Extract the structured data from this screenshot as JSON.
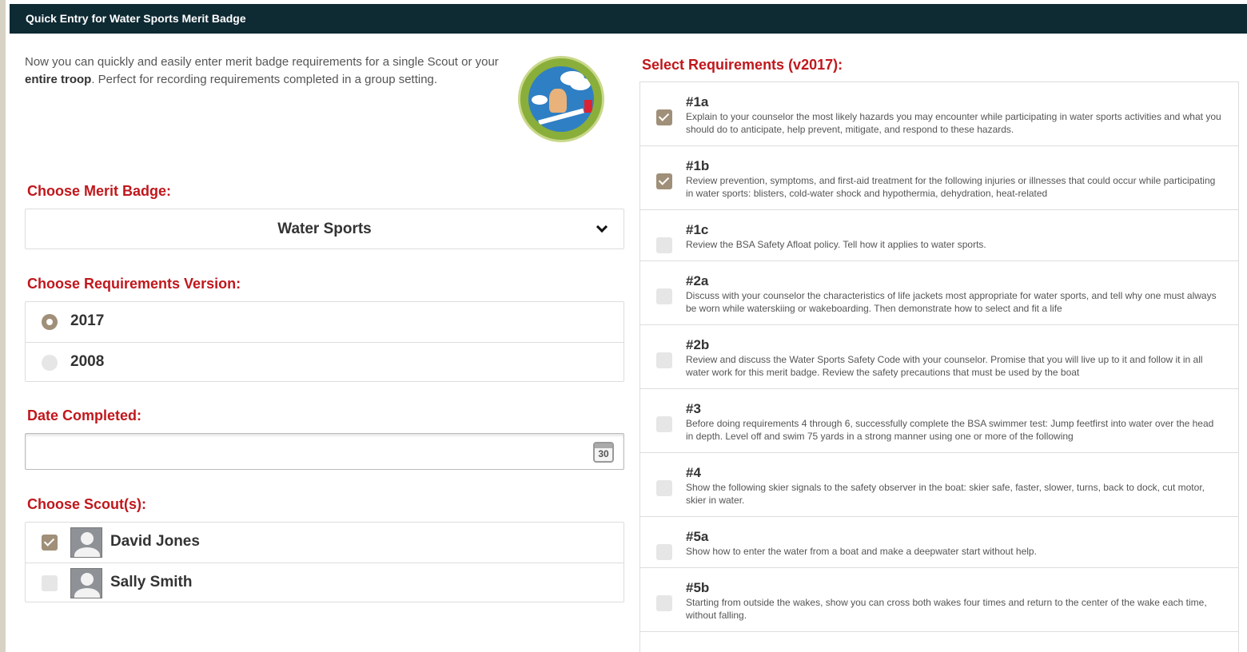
{
  "header": {
    "title": "Quick Entry for Water Sports Merit Badge"
  },
  "intro": {
    "text_before": "Now you can quickly and easily enter merit badge requirements for a single Scout or your ",
    "bold": "entire troop",
    "text_after": ". Perfect for recording requirements completed in a group setting."
  },
  "badge_section": {
    "label": "Choose Merit Badge:",
    "selected": "Water Sports"
  },
  "version_section": {
    "label": "Choose Requirements Version:",
    "options": [
      {
        "label": "2017",
        "selected": true
      },
      {
        "label": "2008",
        "selected": false
      }
    ]
  },
  "date_section": {
    "label": "Date Completed:",
    "value": "",
    "calendar_day": "30"
  },
  "scouts_section": {
    "label": "Choose Scout(s):",
    "scouts": [
      {
        "name": "David Jones",
        "checked": true
      },
      {
        "name": "Sally Smith",
        "checked": false
      }
    ]
  },
  "requirements": {
    "title": "Select Requirements (v2017):",
    "items": [
      {
        "num": "#1a",
        "checked": true,
        "text": "Explain to your counselor the most likely hazards you may encounter while participating in water sports activities and what you should do to anticipate, help prevent, mitigate, and respond to these hazards."
      },
      {
        "num": "#1b",
        "checked": true,
        "text": "Review prevention, symptoms, and first-aid treatment for the following injuries or illnesses that could occur while participating in water sports: blisters, cold-water shock and hypothermia, dehydration, heat-related"
      },
      {
        "num": "#1c",
        "checked": false,
        "text": "Review the BSA Safety Afloat policy. Tell how it applies to water sports."
      },
      {
        "num": "#2a",
        "checked": false,
        "text": "Discuss with your counselor the characteristics of life jackets most appropriate for water sports, and tell why one must always be worn while waterskiing or wakeboarding. Then demonstrate how to select and fit a life"
      },
      {
        "num": "#2b",
        "checked": false,
        "text": "Review and discuss the Water Sports Safety Code with your counselor. Promise that you will live up to it and follow it in all water work for this merit badge. Review the safety precautions that must be used by the boat"
      },
      {
        "num": "#3",
        "checked": false,
        "text": "Before doing requirements 4 through 6, successfully complete the BSA swimmer test: Jump feetfirst into water over the head in depth. Level off and swim 75 yards in a strong manner using one or more of the following"
      },
      {
        "num": "#4",
        "checked": false,
        "text": "Show the following skier signals to the safety observer in the boat: skier safe, faster, slower, turns, back to dock, cut motor, skier in water."
      },
      {
        "num": "#5a",
        "checked": false,
        "text": "Show how to enter the water from a boat and make a deepwater start without help."
      },
      {
        "num": "#5b",
        "checked": false,
        "text": "Starting from outside the wakes, show you can cross both wakes four times and return to the center of the wake each time, without falling."
      }
    ]
  }
}
